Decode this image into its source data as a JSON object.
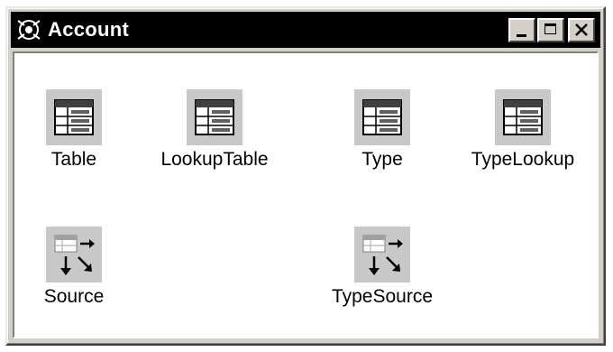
{
  "window": {
    "title": "Account",
    "title_icon": "query-icon",
    "buttons": {
      "minimize": "minimize-icon",
      "maximize": "maximize-icon",
      "close": "close-icon"
    }
  },
  "items": [
    {
      "label": "Table",
      "icon": "table-icon"
    },
    {
      "label": "LookupTable",
      "icon": "table-icon"
    },
    {
      "label": "Type",
      "icon": "table-icon"
    },
    {
      "label": "TypeLookup",
      "icon": "table-icon"
    },
    {
      "label": "Source",
      "icon": "query-source-icon"
    },
    {
      "label": "TypeSource",
      "icon": "query-source-icon"
    }
  ],
  "colors": {
    "titlebar": "#000000",
    "frame": "#d4d0c8",
    "client": "#ffffff"
  }
}
